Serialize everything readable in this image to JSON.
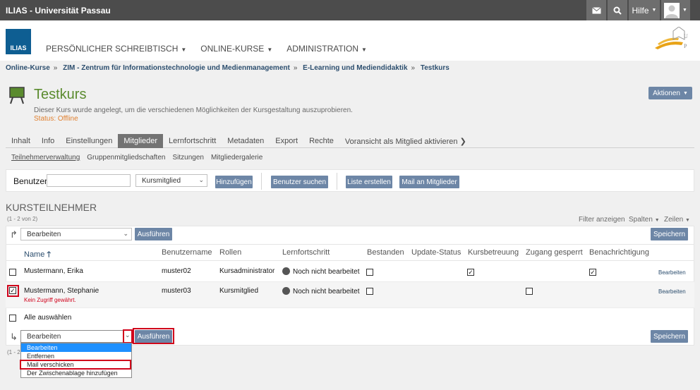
{
  "topbar": {
    "title": "ILIAS - Universität Passau",
    "help_label": "Hilfe"
  },
  "header": {
    "logo_text": "ILIAS",
    "nav": [
      "PERSÖNLICHER SCHREIBTISCH",
      "ONLINE-KURSE",
      "ADMINISTRATION"
    ]
  },
  "breadcrumb": [
    "Online-Kurse",
    "ZIM - Zentrum für Informationstechnologie und Medienmanagement",
    "E-Learning und Mediendidaktik",
    "Testkurs"
  ],
  "course": {
    "title": "Testkurs",
    "description": "Dieser Kurs wurde angelegt, um die verschiedenen Möglichkeiten der Kursgestaltung auszuprobieren.",
    "status": "Status: Offline",
    "actions_label": "Aktionen"
  },
  "tabs": [
    "Inhalt",
    "Info",
    "Einstellungen",
    "Mitglieder",
    "Lernfortschritt",
    "Metadaten",
    "Export",
    "Rechte",
    "Voransicht als Mitglied aktivieren"
  ],
  "subtabs": [
    "Teilnehmerverwaltung",
    "Gruppenmitgliedschaften",
    "Sitzungen",
    "Mitgliedergalerie"
  ],
  "toolbar": {
    "user_label": "Benutzer",
    "user_value": "",
    "role_select": "Kursmitglied",
    "add_button": "Hinzufügen",
    "search_button": "Benutzer suchen",
    "list_button": "Liste erstellen",
    "mail_button": "Mail an Mitglieder"
  },
  "section": {
    "title": "KURSTEILNEHMER",
    "count": "(1 - 2 von 2)",
    "filter_label": "Filter anzeigen",
    "columns_label": "Spalten",
    "rows_label": "Zeilen",
    "count_bottom_partial": "(1 - 2"
  },
  "table": {
    "action_select": "Bearbeiten",
    "execute_button": "Ausführen",
    "save_button": "Speichern",
    "headers": [
      "Name",
      "Benutzername",
      "Rollen",
      "Lernfortschritt",
      "Bestanden",
      "Update-Status",
      "Kursbetreuung",
      "Zugang gesperrt",
      "Benachrichtigung"
    ],
    "rows": [
      {
        "name": "Mustermann, Erika",
        "username": "muster02",
        "role": "Kursadministrator",
        "progress": "Noch nicht bearbeitet",
        "passed": false,
        "tutor": true,
        "blocked": false,
        "notification": true,
        "selected": false,
        "note": "",
        "edit": "Bearbeiten"
      },
      {
        "name": "Mustermann, Stephanie",
        "username": "muster03",
        "role": "Kursmitglied",
        "progress": "Noch nicht bearbeitet",
        "passed": false,
        "tutor": false,
        "blocked": false,
        "notification": false,
        "selected": true,
        "note": "Kein Zugriff gewährt.",
        "edit": "Bearbeiten"
      }
    ],
    "select_all": "Alle auswählen"
  },
  "dropdown": {
    "options": [
      "Bearbeiten",
      "Entfernen",
      "Mail verschicken",
      "Der Zwischenablage hinzufügen"
    ]
  }
}
